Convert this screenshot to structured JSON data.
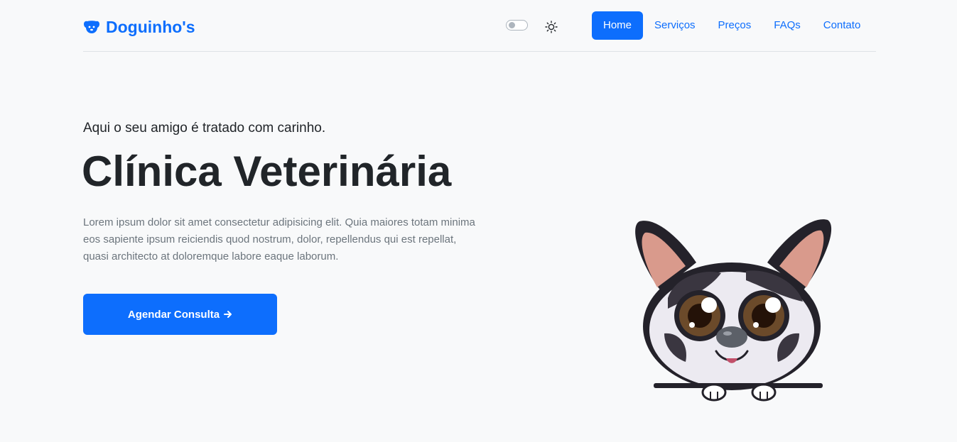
{
  "brand": {
    "name": "Doguinho's",
    "icon": "dog-icon"
  },
  "theme": {
    "toggle_icon": "toggle-switch",
    "mode_icon": "sun-icon",
    "toggle_on": false
  },
  "nav": {
    "items": [
      {
        "label": "Home",
        "active": true
      },
      {
        "label": "Serviços",
        "active": false
      },
      {
        "label": "Preços",
        "active": false
      },
      {
        "label": "FAQs",
        "active": false
      },
      {
        "label": "Contato",
        "active": false
      }
    ]
  },
  "hero": {
    "kicker": "Aqui o seu amigo é tratado com carinho.",
    "title": "Clínica Veterinária",
    "lead": "Lorem ipsum dolor sit amet consectetur adipisicing elit. Quia maiores totam minima eos sapiente ipsum reiciendis quod nostrum, dolor, repellendus qui est repellat, quasi architecto at doloremque labore eaque laborum.",
    "cta_label": "Agendar Consulta",
    "cta_icon": "arrow-right-icon",
    "image": "dog-illustration"
  },
  "colors": {
    "primary": "#0d6efd",
    "background": "#f8f9fa",
    "text": "#212529",
    "muted": "#6c757d"
  }
}
